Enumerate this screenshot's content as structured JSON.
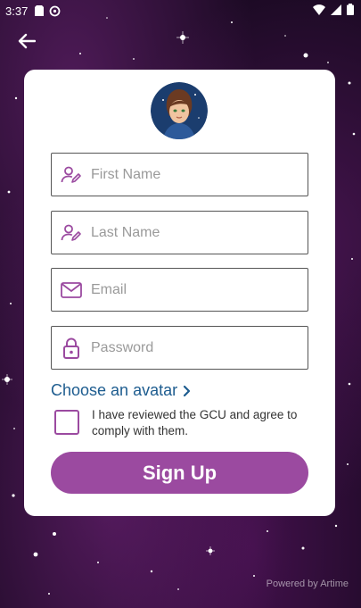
{
  "status_bar": {
    "time": "3:37",
    "left_icons": [
      "sim-card-icon",
      "data-saver-icon"
    ],
    "right_icons": [
      "wifi-icon",
      "cellular-signal-icon",
      "battery-icon"
    ]
  },
  "header": {
    "back_icon": "arrow-left-icon"
  },
  "form": {
    "avatar_icon": "avatar-image",
    "fields": {
      "first_name": {
        "placeholder": "First Name",
        "value": "",
        "icon": "user-edit-icon"
      },
      "last_name": {
        "placeholder": "Last Name",
        "value": "",
        "icon": "user-edit-icon"
      },
      "email": {
        "placeholder": "Email",
        "value": "",
        "icon": "envelope-icon"
      },
      "password": {
        "placeholder": "Password",
        "value": "",
        "icon": "lock-icon"
      }
    },
    "choose_avatar_label": "Choose an avatar",
    "gcu_text": "I have reviewed the GCU and agree to comply with them.",
    "gcu_checked": false,
    "signup_label": "Sign Up"
  },
  "footer": {
    "powered_by": "Powered by Artime"
  },
  "colors": {
    "accent": "#9b4aa0",
    "link": "#1d5c8f",
    "card": "#ffffff"
  }
}
